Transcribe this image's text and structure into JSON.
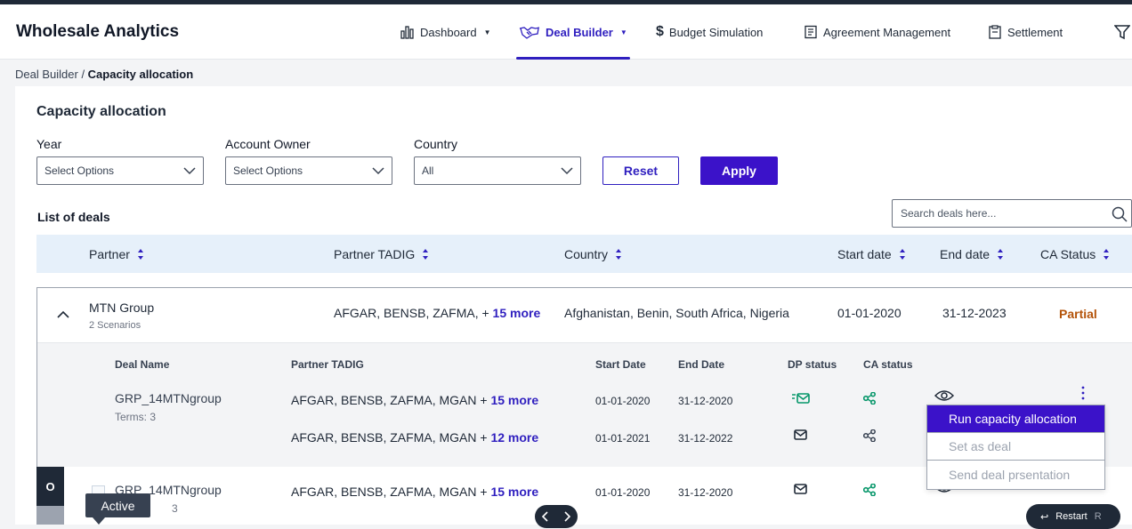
{
  "app": {
    "title": "Wholesale Analytics"
  },
  "nav": {
    "dashboard": "Dashboard",
    "deal_builder": "Deal Builder",
    "budget_simulation": "Budget Simulation",
    "agreement_management": "Agreement Management",
    "settlement": "Settlement"
  },
  "breadcrumb": {
    "parent": "Deal Builder",
    "sep": " / ",
    "current": "Capacity allocation"
  },
  "page": {
    "title": "Capacity allocation"
  },
  "filters": {
    "year": {
      "label": "Year",
      "value": "Select Options"
    },
    "account_owner": {
      "label": "Account Owner",
      "value": "Select Options"
    },
    "country": {
      "label": "Country",
      "value": "All"
    },
    "reset": "Reset",
    "apply": "Apply"
  },
  "list": {
    "title": "List of deals",
    "search_placeholder": "Search deals here..."
  },
  "columns": {
    "partner": "Partner",
    "partner_tadig": "Partner TADIG",
    "country": "Country",
    "start_date": "Start date",
    "end_date": "End date",
    "ca_status": "CA Status"
  },
  "group": {
    "partner": "MTN Group",
    "scenarios": "2 Scenarios",
    "tadig": "AFGAR, BENSB, ZAFMA,  + ",
    "tadig_more": "15 more",
    "country": "Afghanistan, Benin, South Africa, Nigeria",
    "start": "01-01-2020",
    "end": "31-12-2023",
    "status": "Partial"
  },
  "subcolumns": {
    "deal_name": "Deal Name",
    "partner_tadig": "Partner TADIG",
    "start_date": "Start Date",
    "end_date": "End Date",
    "dp_status": "DP status",
    "ca_status": "CA status"
  },
  "deal": {
    "name": "GRP_14MTNgroup",
    "terms": "Terms: 3",
    "rows": [
      {
        "tadig": "AFGAR, BENSB, ZAFMA, MGAN + ",
        "more": "15 more",
        "start": "01-01-2020",
        "end": "31-12-2020"
      },
      {
        "tadig": "AFGAR, BENSB, ZAFMA, MGAN + ",
        "more": "12 more",
        "start": "01-01-2021",
        "end": "31-12-2022"
      }
    ]
  },
  "menu": {
    "run": "Run capacity allocation",
    "set_deal": "Set as deal",
    "send": "Send deal prsentation"
  },
  "row2": {
    "side_letter": "O",
    "name": "GRP_14MTNgroup",
    "terms_partial": "3",
    "tadig": "AFGAR, BENSB, ZAFMA, MGAN + ",
    "more": "15 more",
    "start": "01-01-2020",
    "end": "31-12-2020"
  },
  "overlay": {
    "tooltip": "Active",
    "restart": "Restart",
    "restart_key": "R"
  },
  "colors": {
    "primary": "#3b12c9",
    "status_partial": "#b45309",
    "status_green": "#059669",
    "header_bg": "#e6f0fa"
  },
  "icons": [
    "bar-chart-icon",
    "handshake-icon",
    "dollar-icon",
    "document-icon",
    "clipboard-icon",
    "filter-icon",
    "chevron-down-icon",
    "search-icon",
    "sort-icon",
    "chevron-up-icon",
    "mail-check-icon",
    "mail-icon",
    "share-icon",
    "eye-icon",
    "kebab-icon"
  ]
}
